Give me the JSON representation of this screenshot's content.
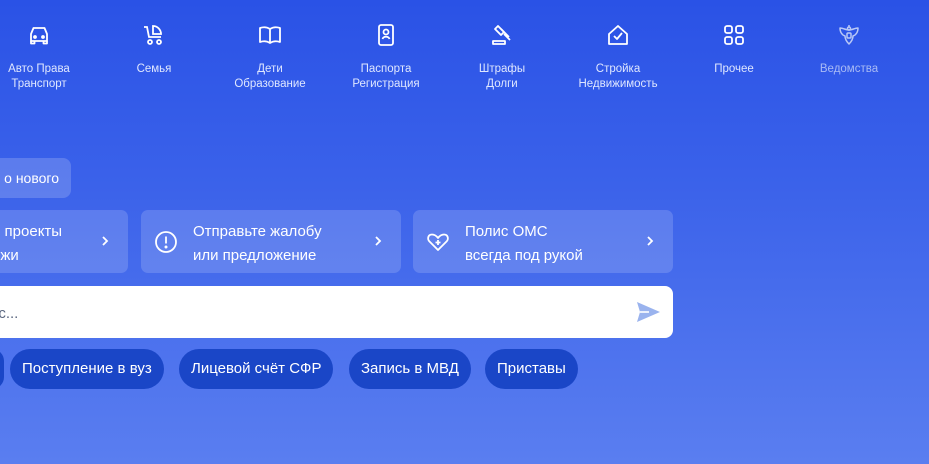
{
  "categories": [
    {
      "line1": "Авто Права",
      "line2": "Транспорт",
      "icon": "car-icon"
    },
    {
      "line1": "Семья",
      "line2": "",
      "icon": "baby-stroller-icon"
    },
    {
      "line1": "Дети",
      "line2": "Образование",
      "icon": "book-icon"
    },
    {
      "line1": "Паспорта",
      "line2": "Регистрация",
      "icon": "passport-icon"
    },
    {
      "line1": "Штрафы",
      "line2": "Долги",
      "icon": "gavel-icon"
    },
    {
      "line1": "Стройка",
      "line2": "Недвижимость",
      "icon": "house-icon"
    },
    {
      "line1": "Прочее",
      "line2": "",
      "icon": "grid-icon"
    },
    {
      "line1": "Ведомства",
      "line2": "",
      "icon": "coat-of-arms-icon"
    }
  ],
  "promo": {
    "partial_label": "о нового"
  },
  "cards": [
    {
      "line1": "и проекты",
      "line2": "ёжи",
      "icon": ""
    },
    {
      "line1": "Отправьте жалобу",
      "line2": "или предложение",
      "icon": "exclamation-circle-icon"
    },
    {
      "line1": "Полис ОМС",
      "line2": "всегда под рукой",
      "icon": "heart-plus-icon"
    }
  ],
  "search": {
    "placeholder": "ос...",
    "send_icon": "send-icon"
  },
  "chips": [
    "Поступление в вуз",
    "Лицевой счёт СФР",
    "Запись в МВД",
    "Приставы"
  ],
  "colors": {
    "accent": "#2a52e6",
    "chip": "#1a46c7",
    "send": "#9ab3ee"
  }
}
